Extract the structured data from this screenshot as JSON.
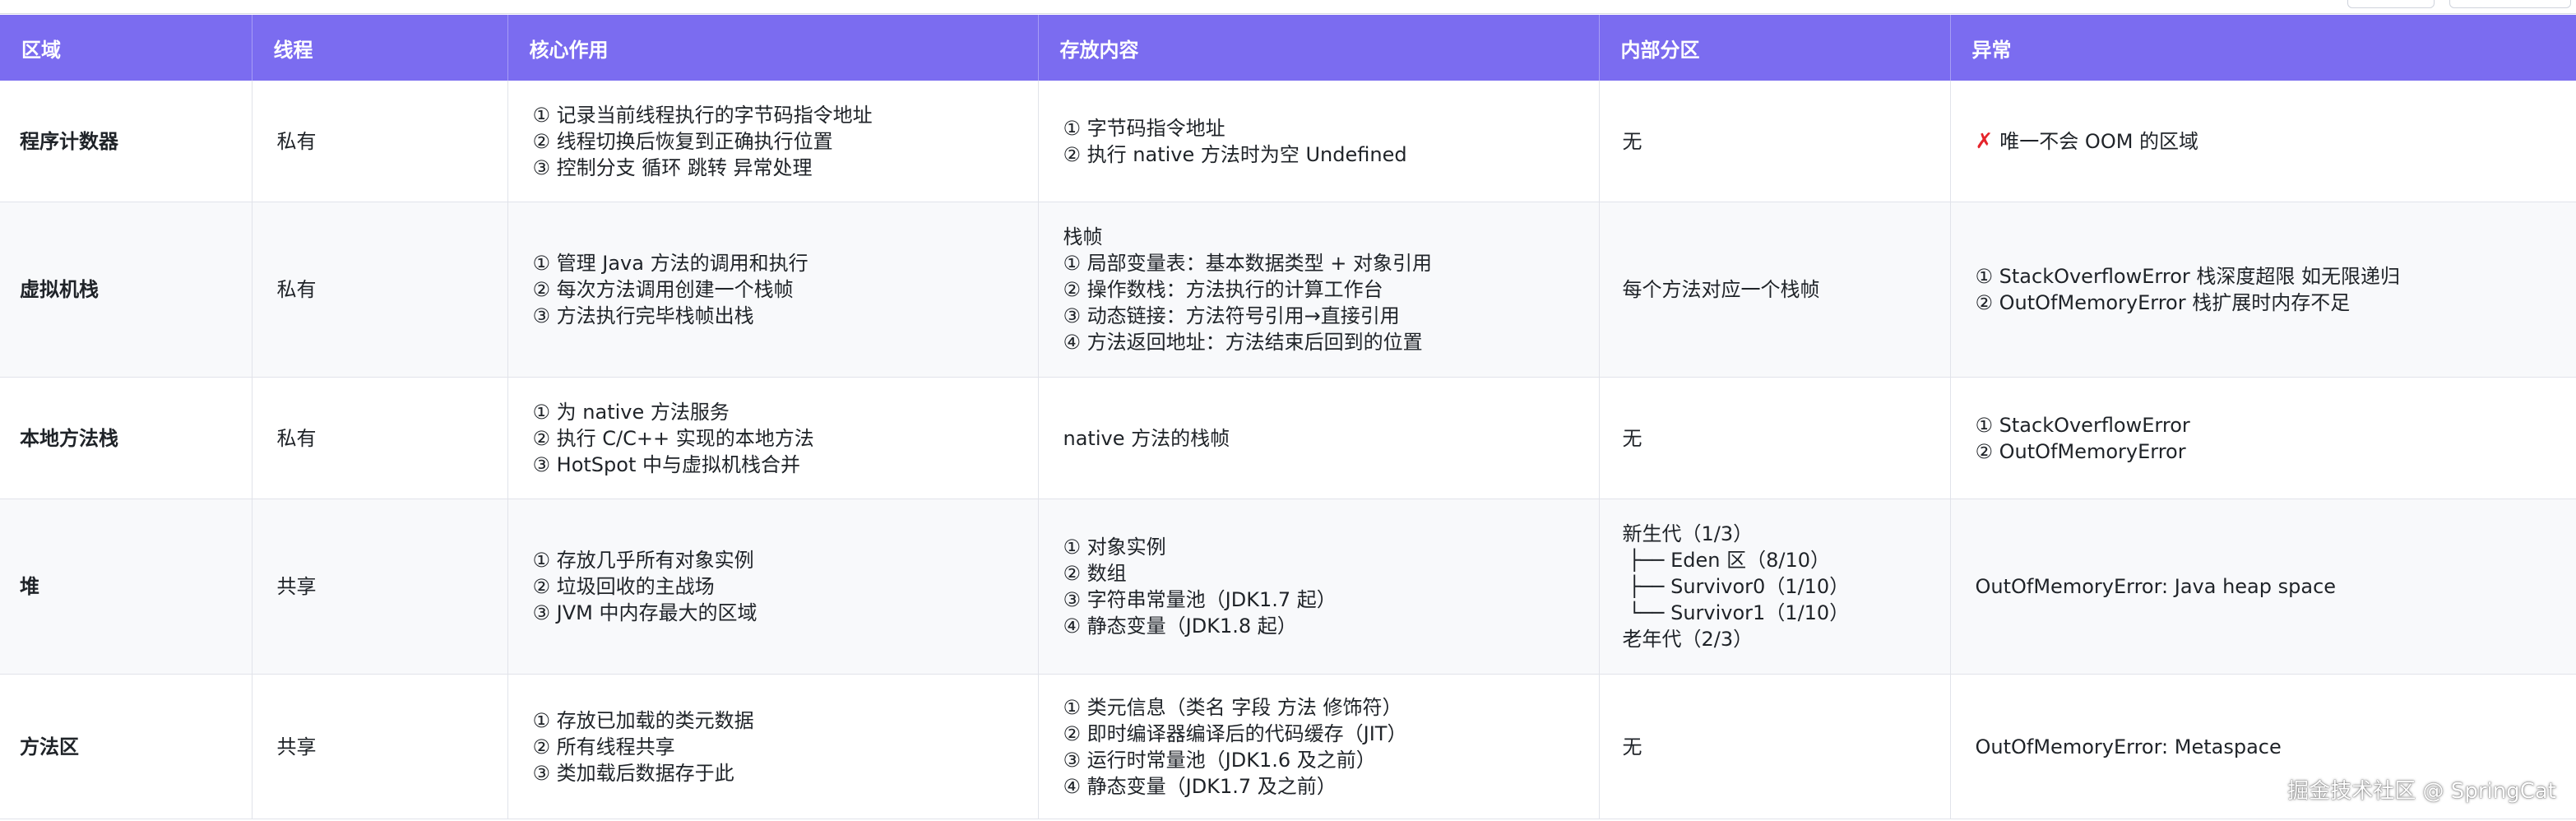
{
  "table": {
    "headers": [
      "区域",
      "线程",
      "核心作用",
      "存放内容",
      "内部分区",
      "异常"
    ],
    "rows": [
      {
        "region": "程序计数器",
        "thread": "私有",
        "role": [
          "① 记录当前线程执行的字节码指令地址",
          "② 线程切换后恢复到正确执行位置",
          "③ 控制分支 循环 跳转 异常处理"
        ],
        "contents": [
          "① 字节码指令地址",
          "② 执行 native 方法时为空 Undefined"
        ],
        "partitions": [
          "无"
        ],
        "exceptions": [
          "唯一不会 OOM 的区域"
        ],
        "exception_icon": "cross-icon"
      },
      {
        "region": "虚拟机栈",
        "thread": "私有",
        "role": [
          "① 管理 Java 方法的调用和执行",
          "② 每次方法调用创建一个栈帧",
          "③ 方法执行完毕栈帧出栈"
        ],
        "contents": [
          "栈帧",
          "① 局部变量表：基本数据类型 + 对象引用",
          "② 操作数栈：方法执行的计算工作台",
          "③ 动态链接：方法符号引用→直接引用",
          "④ 方法返回地址：方法结束后回到的位置"
        ],
        "partitions": [
          "每个方法对应一个栈帧"
        ],
        "exceptions": [
          "① StackOverflowError 栈深度超限 如无限递归",
          "② OutOfMemoryError 栈扩展时内存不足"
        ]
      },
      {
        "region": "本地方法栈",
        "thread": "私有",
        "role": [
          "① 为 native 方法服务",
          "② 执行 C/C++ 实现的本地方法",
          "③ HotSpot 中与虚拟机栈合并"
        ],
        "contents": [
          "native 方法的栈帧"
        ],
        "partitions": [
          "无"
        ],
        "exceptions": [
          "① StackOverflowError",
          "② OutOfMemoryError"
        ]
      },
      {
        "region": "堆",
        "thread": "共享",
        "role": [
          "① 存放几乎所有对象实例",
          "② 垃圾回收的主战场",
          "③ JVM 中内存最大的区域"
        ],
        "contents": [
          "① 对象实例",
          "② 数组",
          "③ 字符串常量池（JDK1.7 起）",
          "④ 静态变量（JDK1.8 起）"
        ],
        "partitions": [
          "新生代（1/3）",
          " ├── Eden 区（8/10）",
          " ├── Survivor0（1/10）",
          " └── Survivor1（1/10）",
          "老年代（2/3）"
        ],
        "exceptions": [
          "OutOfMemoryError: Java heap space"
        ]
      },
      {
        "region": "方法区",
        "thread": "共享",
        "role": [
          "① 存放已加载的类元数据",
          "② 所有线程共享",
          "③ 类加载后数据存于此"
        ],
        "contents": [
          "① 类元信息（类名 字段 方法 修饰符）",
          "② 即时编译器编译后的代码缓存（JIT）",
          "③ 运行时常量池（JDK1.6 及之前）",
          "④ 静态变量（JDK1.7 及之前）"
        ],
        "partitions": [
          "无"
        ],
        "exceptions": [
          "OutOfMemoryError: Metaspace"
        ]
      }
    ]
  },
  "watermark": "掘金技术社区 @ SpringCat",
  "colors": {
    "header_bg": "#7b6cf0",
    "header_text": "#ffffff",
    "error_icon": "#e5242b",
    "border": "#e1e3ea"
  }
}
